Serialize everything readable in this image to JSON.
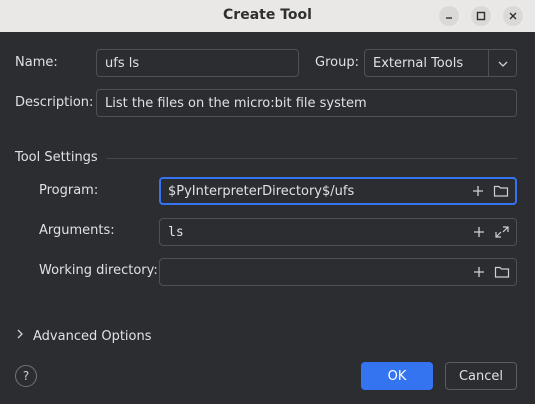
{
  "window": {
    "title": "Create Tool",
    "controls": [
      "minimize-icon",
      "maximize-icon",
      "close-icon"
    ]
  },
  "form": {
    "name_label": "Name:",
    "name_value": "ufs ls",
    "group_label": "Group:",
    "group_value": "External Tools",
    "description_label": "Description:",
    "description_value": "List the files on the micro:bit file system"
  },
  "tool_settings": {
    "section_title": "Tool Settings",
    "program_label": "Program:",
    "program_value": "$PyInterpreterDirectory$/ufs",
    "arguments_label": "Arguments:",
    "arguments_value": "ls",
    "working_dir_label": "Working directory:",
    "working_dir_value": ""
  },
  "advanced": {
    "label": "Advanced Options",
    "expanded": false
  },
  "footer": {
    "help_label": "?",
    "ok_label": "OK",
    "cancel_label": "Cancel"
  },
  "colors": {
    "background": "#2b2d30",
    "accent": "#3574f0",
    "titlebar": "#e9e8e6"
  }
}
